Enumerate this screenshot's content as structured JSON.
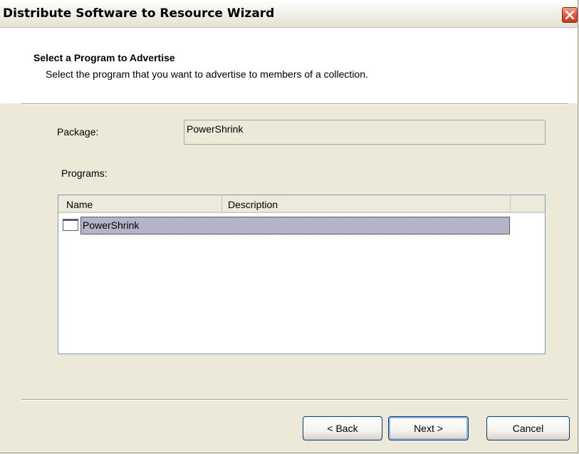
{
  "window": {
    "title": "Distribute Software to Resource Wizard",
    "close_icon": "close-icon",
    "accent_color": "#e0553a"
  },
  "header": {
    "title": "Select a Program to Advertise",
    "subtitle": "Select the program that you want to advertise to members of a collection."
  },
  "package": {
    "label": "Package:",
    "value": "PowerShrink"
  },
  "programs": {
    "label": "Programs:",
    "columns": [
      "Name",
      "Description",
      ""
    ],
    "rows": [
      {
        "name": "PowerShrink",
        "description": "",
        "selected": true,
        "icon": "program-icon"
      }
    ]
  },
  "buttons": {
    "back": "< Back",
    "next": "Next >",
    "cancel": "Cancel"
  }
}
